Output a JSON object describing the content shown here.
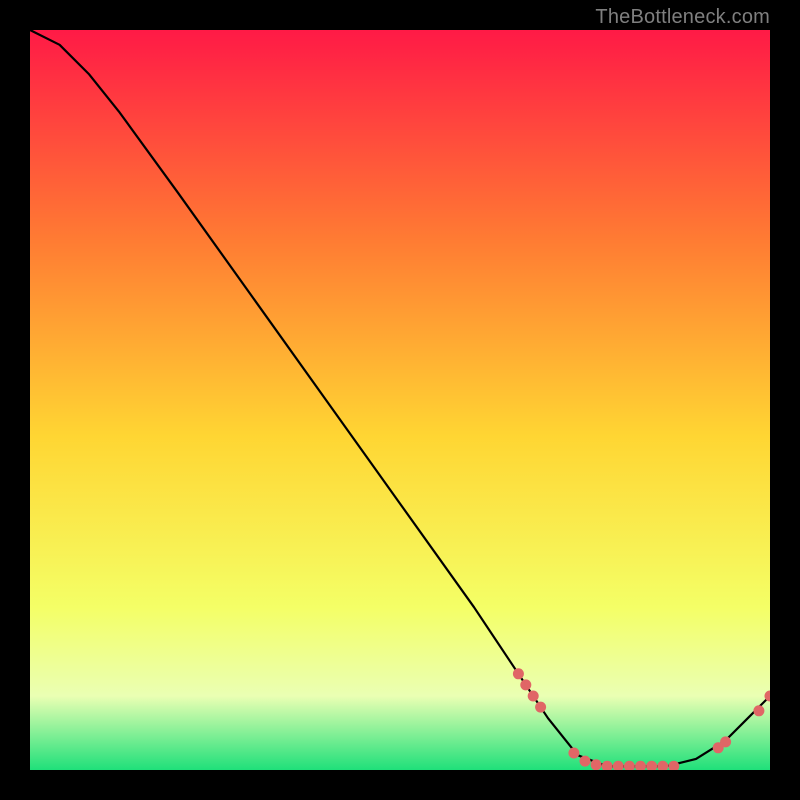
{
  "watermark": "TheBottleneck.com",
  "colors": {
    "bg": "#000000",
    "grad_top": "#ff1a46",
    "grad_mid_upper": "#ff7a33",
    "grad_mid": "#ffd633",
    "grad_lower": "#f4ff66",
    "grad_pale": "#eaffb3",
    "grad_green": "#1fe07a",
    "curve": "#000000",
    "dot_fill": "#e06666",
    "watermark": "#7f7f7f"
  },
  "chart_data": {
    "type": "line",
    "title": "",
    "xlabel": "",
    "ylabel": "",
    "xlim": [
      0,
      100
    ],
    "ylim": [
      0,
      100
    ],
    "notes": "V-shaped bottleneck curve on red→green vertical gradient. Optimum (y≈0) around x≈80. Dots mark points read off the curve near the trough and right upturn.",
    "curve": [
      {
        "x": 0,
        "y": 100
      },
      {
        "x": 4,
        "y": 98
      },
      {
        "x": 8,
        "y": 94
      },
      {
        "x": 12,
        "y": 89
      },
      {
        "x": 20,
        "y": 78
      },
      {
        "x": 30,
        "y": 64
      },
      {
        "x": 40,
        "y": 50
      },
      {
        "x": 50,
        "y": 36
      },
      {
        "x": 60,
        "y": 22
      },
      {
        "x": 66,
        "y": 13
      },
      {
        "x": 70,
        "y": 7
      },
      {
        "x": 74,
        "y": 2
      },
      {
        "x": 78,
        "y": 0.5
      },
      {
        "x": 82,
        "y": 0.5
      },
      {
        "x": 86,
        "y": 0.5
      },
      {
        "x": 90,
        "y": 1.5
      },
      {
        "x": 94,
        "y": 4
      },
      {
        "x": 97,
        "y": 7
      },
      {
        "x": 100,
        "y": 10
      }
    ],
    "dots": [
      {
        "x": 66.0,
        "y": 13.0
      },
      {
        "x": 67.0,
        "y": 11.5
      },
      {
        "x": 68.0,
        "y": 10.0
      },
      {
        "x": 69.0,
        "y": 8.5
      },
      {
        "x": 73.5,
        "y": 2.3
      },
      {
        "x": 75.0,
        "y": 1.2
      },
      {
        "x": 76.5,
        "y": 0.7
      },
      {
        "x": 78.0,
        "y": 0.5
      },
      {
        "x": 79.5,
        "y": 0.5
      },
      {
        "x": 81.0,
        "y": 0.5
      },
      {
        "x": 82.5,
        "y": 0.5
      },
      {
        "x": 84.0,
        "y": 0.5
      },
      {
        "x": 85.5,
        "y": 0.5
      },
      {
        "x": 87.0,
        "y": 0.5
      },
      {
        "x": 93.0,
        "y": 3.0
      },
      {
        "x": 94.0,
        "y": 3.8
      },
      {
        "x": 98.5,
        "y": 8.0
      },
      {
        "x": 100.0,
        "y": 10.0
      }
    ]
  }
}
